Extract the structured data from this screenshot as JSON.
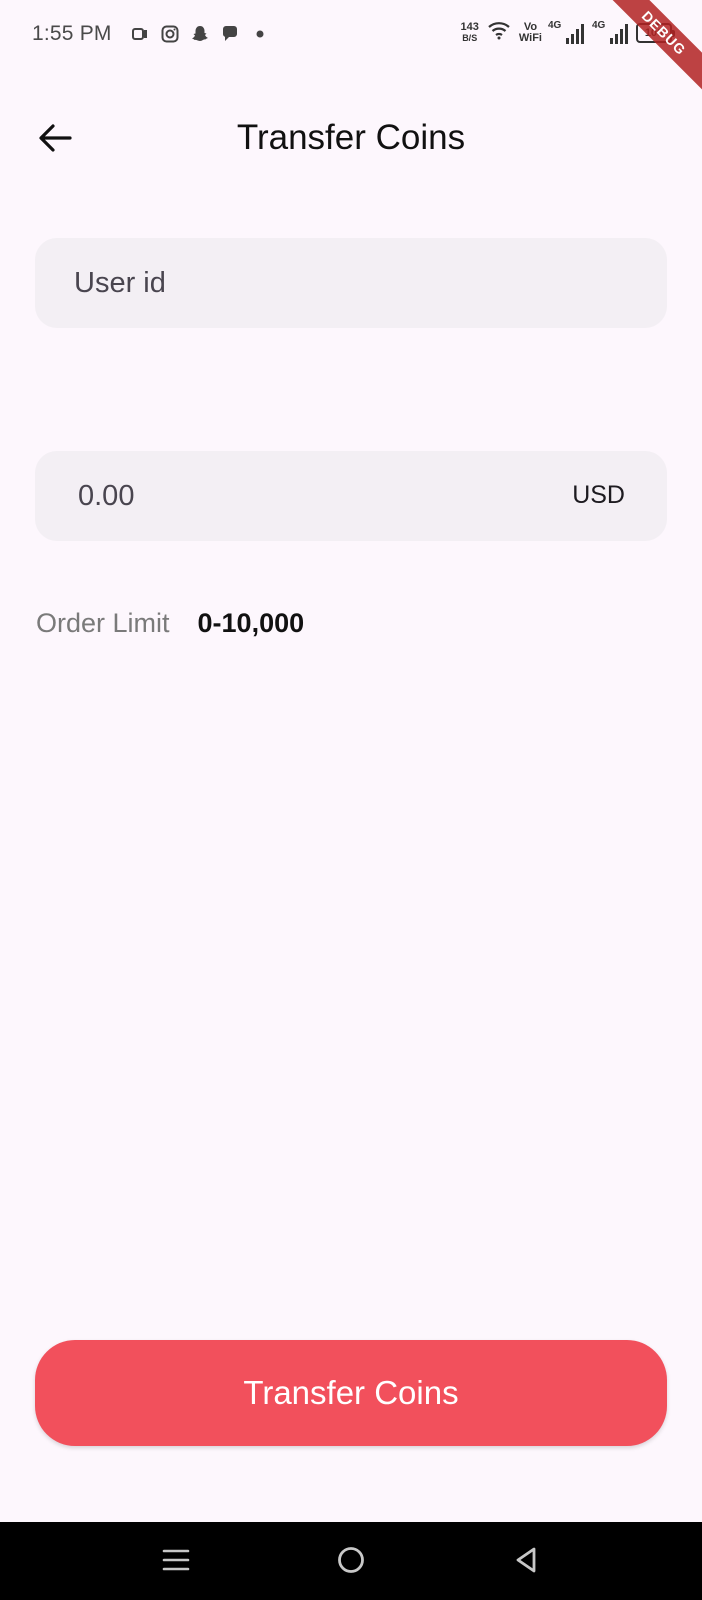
{
  "status_bar": {
    "time": "1:55 PM",
    "notification_icons": [
      "screen-record-icon",
      "instagram-icon",
      "snapchat-icon",
      "chat-bubble-icon",
      "dot-icon"
    ],
    "net_speed_value": "143",
    "net_speed_unit": "B/S",
    "vowifi_top": "Vo",
    "vowifi_bottom": "WiFi",
    "sim1_label": "4G",
    "sim2_label": "4G",
    "battery": "100"
  },
  "debug_banner": "DEBUG",
  "app_bar": {
    "back_icon": "arrow-left-icon",
    "title": "Transfer Coins"
  },
  "form": {
    "user_id": {
      "value": "",
      "placeholder": "User id"
    },
    "amount": {
      "value": "",
      "placeholder": "0.00",
      "currency": "USD"
    },
    "order_limit": {
      "label": "Order Limit",
      "value": "0-10,000"
    }
  },
  "actions": {
    "transfer_label": "Transfer Coins"
  },
  "colors": {
    "background": "#fdf7fd",
    "field_background": "#f3eff4",
    "primary_button": "#f2505c",
    "nav_bar": "#000000"
  },
  "nav_bar": {
    "buttons": [
      "menu-icon",
      "home-circle-icon",
      "back-triangle-icon"
    ]
  }
}
